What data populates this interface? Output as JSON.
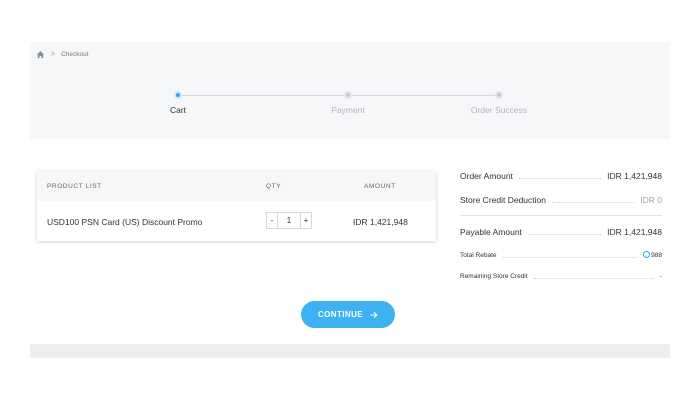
{
  "breadcrumb": {
    "home_icon": "home-icon",
    "current": "Checkout"
  },
  "steps": [
    {
      "label": "Cart",
      "state": "active"
    },
    {
      "label": "Payment",
      "state": "pending"
    },
    {
      "label": "Order Success",
      "state": "pending"
    }
  ],
  "cart": {
    "headers": {
      "product": "PRODUCT LIST",
      "qty": "QTY",
      "amount": "AMOUNT"
    },
    "items": [
      {
        "name": "USD100 PSN Card (US) Discount Promo",
        "qty": "1",
        "qty_minus": "-",
        "qty_plus": "+",
        "amount": "IDR 1,421,948"
      }
    ]
  },
  "summary": {
    "order_amount": {
      "label": "Order Amount",
      "value": "IDR 1,421,948"
    },
    "store_credit": {
      "label": "Store Credit Deduction",
      "value": "IDR 0"
    },
    "payable": {
      "label": "Payable Amount",
      "value": "IDR 1,421,948"
    },
    "rebate": {
      "label": "Total Rebate",
      "value": "988"
    },
    "remaining": {
      "label": "Remaining Store Credit",
      "value": "-"
    }
  },
  "continue_button": {
    "label": "CONTINUE",
    "icon": "arrow-right-icon"
  },
  "colors": {
    "accent": "#3db1f2",
    "band": "#f6f7f9"
  }
}
